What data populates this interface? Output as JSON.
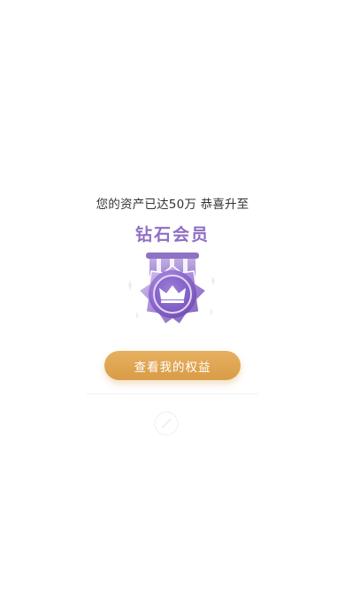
{
  "dialog": {
    "subtitle": "您的资产已达50万 恭喜升至",
    "level_title": "钻石会员",
    "action_label": "查看我的权益"
  },
  "icons": {
    "medal": "diamond-member-medal-icon",
    "close": "close-icon"
  },
  "colors": {
    "accent_purple": "#8e6fc4",
    "button_orange": "#e0a656",
    "text_dark": "#333333"
  }
}
